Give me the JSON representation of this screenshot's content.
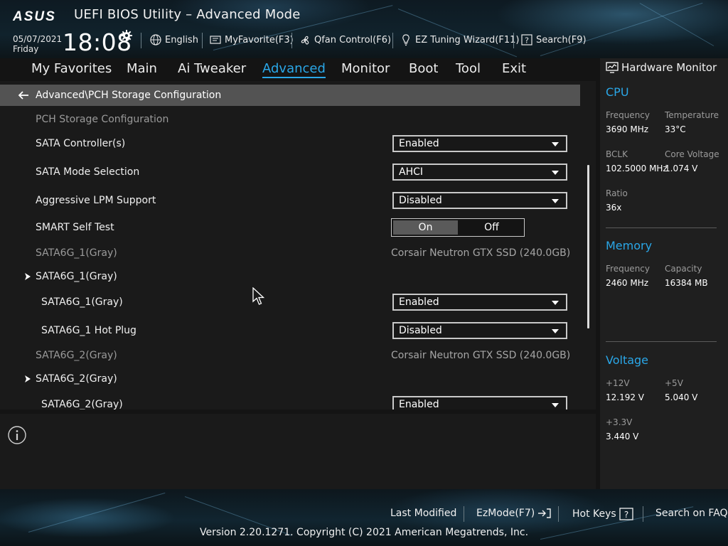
{
  "header": {
    "title": "UEFI BIOS Utility – Advanced Mode",
    "brand": "ASUS",
    "date": "05/07/2021",
    "day": "Friday",
    "time": "18:08",
    "tools": [
      {
        "label": "English",
        "icon": "globe-icon"
      },
      {
        "label": "MyFavorite(F3)",
        "icon": "favorite-icon"
      },
      {
        "label": "Qfan Control(F6)",
        "icon": "fan-icon"
      },
      {
        "label": "EZ Tuning Wizard(F11)",
        "icon": "lightbulb-icon"
      },
      {
        "label": "Search(F9)",
        "icon": "search-help-icon"
      }
    ]
  },
  "nav": {
    "tabs": [
      "My Favorites",
      "Main",
      "Ai Tweaker",
      "Advanced",
      "Monitor",
      "Boot",
      "Tool",
      "Exit"
    ],
    "active": "Advanced"
  },
  "main": {
    "breadcrumb": "Advanced\\PCH Storage Configuration",
    "section_title": "PCH Storage Configuration",
    "rows": [
      {
        "label": "SATA Controller(s)",
        "value": "Enabled"
      },
      {
        "label": "SATA Mode Selection",
        "value": "AHCI"
      },
      {
        "label": "Aggressive LPM Support",
        "value": "Disabled"
      },
      {
        "label": "SMART Self Test",
        "on": "On",
        "off": "Off"
      },
      {
        "label": "SATA6G_1(Gray)",
        "info": "Corsair Neutron GTX SSD (240.0GB)"
      },
      {
        "label": "SATA6G_1(Gray)"
      },
      {
        "label": "SATA6G_1(Gray)",
        "value": "Enabled"
      },
      {
        "label": "SATA6G_1 Hot Plug",
        "value": "Disabled"
      },
      {
        "label": "SATA6G_2(Gray)",
        "info": "Corsair Neutron GTX SSD (240.0GB)"
      },
      {
        "label": "SATA6G_2(Gray)"
      },
      {
        "label": "SATA6G_2(Gray)",
        "value": "Enabled"
      }
    ]
  },
  "hw_monitor": {
    "title": "Hardware Monitor",
    "cpu": {
      "title": "CPU",
      "frequency_label": "Frequency",
      "frequency": "3690 MHz",
      "temperature_label": "Temperature",
      "temperature": "33°C",
      "bclk_label": "BCLK",
      "bclk": "102.5000 MHz",
      "core_voltage_label": "Core Voltage",
      "core_voltage": "1.074 V",
      "ratio_label": "Ratio",
      "ratio": "36x"
    },
    "memory": {
      "title": "Memory",
      "frequency_label": "Frequency",
      "frequency": "2460 MHz",
      "capacity_label": "Capacity",
      "capacity": "16384 MB"
    },
    "voltage": {
      "title": "Voltage",
      "v12_label": "+12V",
      "v12": "12.192 V",
      "v5_label": "+5V",
      "v5": "5.040 V",
      "v33_label": "+3.3V",
      "v33": "3.440 V"
    }
  },
  "footer": {
    "last_modified": "Last Modified",
    "ezmode": "EzMode(F7)",
    "hot_keys": "Hot Keys",
    "search_faq": "Search on FAQ",
    "copyright": "Version 2.20.1271. Copyright (C) 2021 American Megatrends, Inc."
  },
  "colors": {
    "accent": "#2aa7e8",
    "breadcrumb_bg": "#535353",
    "panel_bg": "#1a1a1a"
  }
}
